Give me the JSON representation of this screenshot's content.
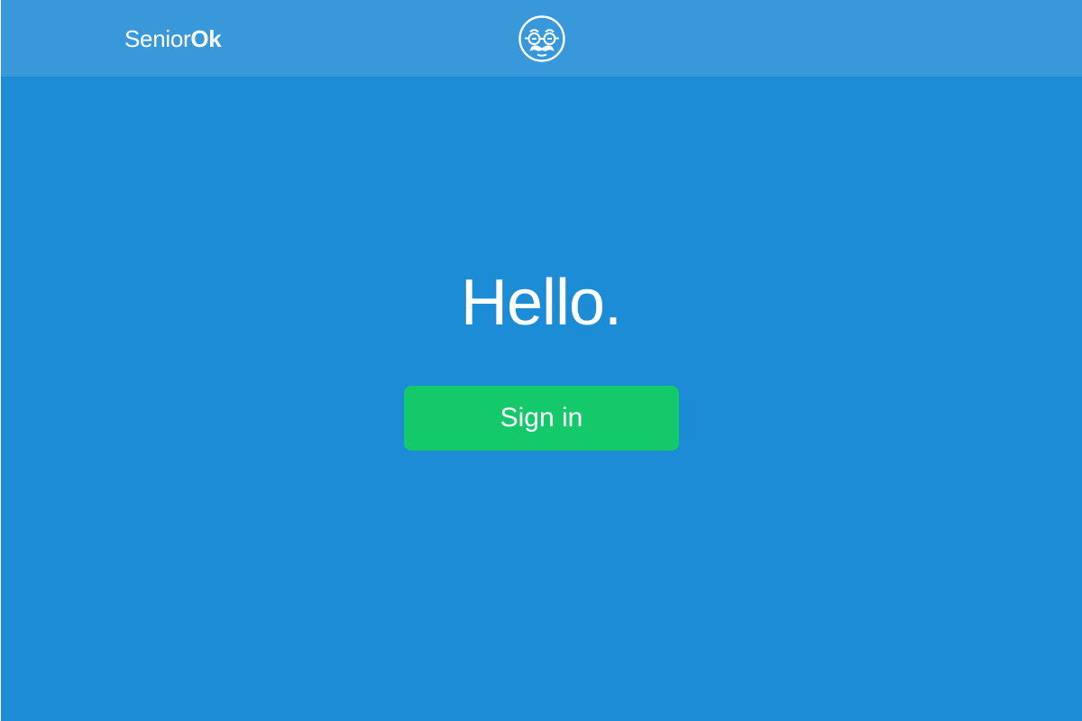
{
  "header": {
    "brand_prefix": "Senior",
    "brand_suffix": "Ok",
    "logo_icon": "senior-face-with-glasses-and-mustache-icon"
  },
  "hero": {
    "title": "Hello.",
    "signin_label": "Sign in"
  },
  "colors": {
    "background": "#1d8cd6",
    "topbar": "#3898da",
    "button": "#14c96a",
    "text": "#ffffff"
  }
}
